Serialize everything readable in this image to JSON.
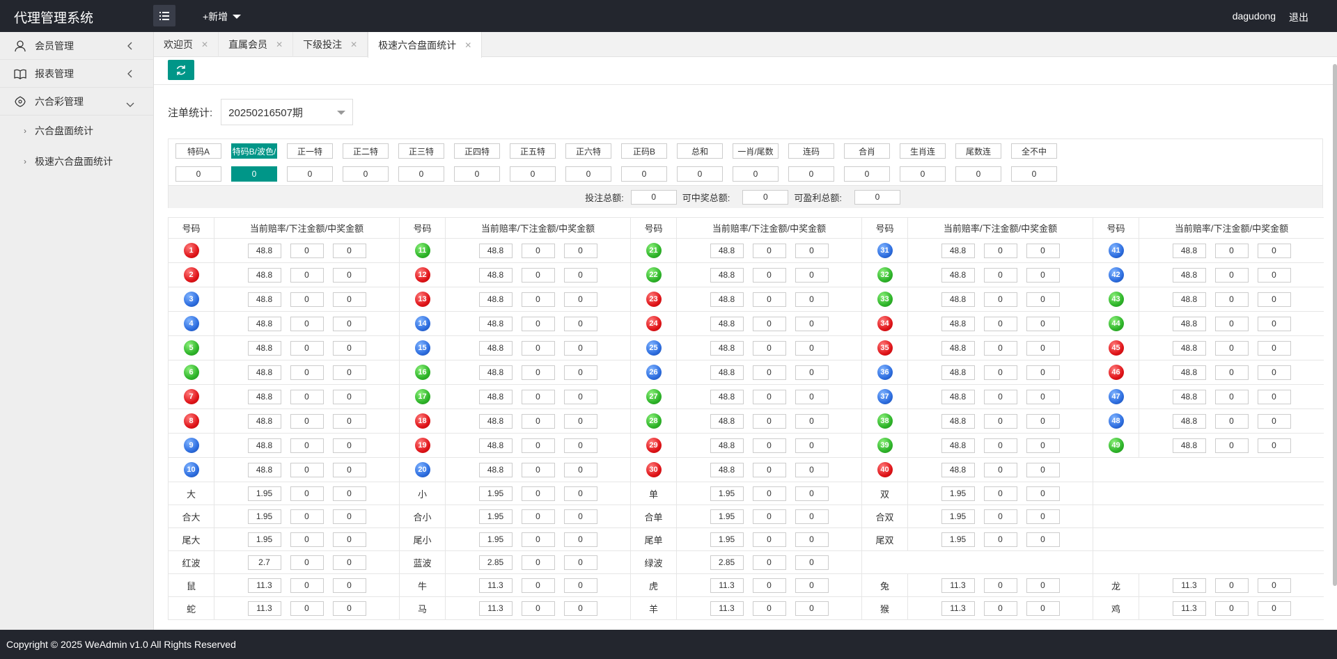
{
  "app": {
    "title": "代理管理系统",
    "add_new": "+新增",
    "user": "dagudong",
    "logout": "退出"
  },
  "sidebar": {
    "items": [
      {
        "label": "会员管理",
        "icon": "user-icon"
      },
      {
        "label": "报表管理",
        "icon": "book-icon"
      },
      {
        "label": "六合彩管理",
        "icon": "lottery-icon"
      }
    ],
    "sub_items": [
      "六合盘面统计",
      "极速六合盘面统计"
    ]
  },
  "tabs": [
    "欢迎页",
    "直属会员",
    "下级投注",
    "极速六合盘面统计"
  ],
  "active_tab": 3,
  "filter": {
    "label": "注单统计:",
    "period": "20250216507期"
  },
  "categories": {
    "labels": [
      "特码A",
      "特码B/波色/",
      "正一特",
      "正二特",
      "正三特",
      "正四特",
      "正五特",
      "正六特",
      "正码B",
      "总和",
      "一肖/尾数",
      "连码",
      "合肖",
      "生肖连",
      "尾数连",
      "全不中"
    ],
    "values": [
      "0",
      "0",
      "0",
      "0",
      "0",
      "0",
      "0",
      "0",
      "0",
      "0",
      "0",
      "0",
      "0",
      "0",
      "0",
      "0"
    ],
    "active_index": 1
  },
  "summary": {
    "bet_total_label": "投注总额:",
    "bet_total": "0",
    "win_total_label": "可中奖总额:",
    "win_total": "0",
    "profit_total_label": "可盈利总额:",
    "profit_total": "0"
  },
  "table": {
    "col_no": "号码",
    "col_vals": "当前赔率/下注金额/中奖金额",
    "odds_number": "48.8",
    "zero": "0",
    "ball_colors": {
      "1": "r",
      "2": "r",
      "3": "b",
      "4": "b",
      "5": "g",
      "6": "g",
      "7": "r",
      "8": "r",
      "9": "b",
      "10": "b",
      "11": "g",
      "12": "r",
      "13": "r",
      "14": "b",
      "15": "b",
      "16": "g",
      "17": "g",
      "18": "r",
      "19": "r",
      "20": "b",
      "21": "g",
      "22": "g",
      "23": "r",
      "24": "r",
      "25": "b",
      "26": "b",
      "27": "g",
      "28": "g",
      "29": "r",
      "30": "r",
      "31": "b",
      "32": "g",
      "33": "g",
      "34": "r",
      "35": "r",
      "36": "b",
      "37": "b",
      "38": "g",
      "39": "g",
      "40": "r",
      "41": "b",
      "42": "b",
      "43": "g",
      "44": "g",
      "45": "r",
      "46": "r",
      "47": "b",
      "48": "b",
      "49": "g"
    },
    "label_rows": [
      [
        [
          "大",
          "1.95"
        ],
        [
          "小",
          "1.95"
        ],
        [
          "单",
          "1.95"
        ],
        [
          "双",
          "1.95"
        ]
      ],
      [
        [
          "合大",
          "1.95"
        ],
        [
          "合小",
          "1.95"
        ],
        [
          "合单",
          "1.95"
        ],
        [
          "合双",
          "1.95"
        ]
      ],
      [
        [
          "尾大",
          "1.95"
        ],
        [
          "尾小",
          "1.95"
        ],
        [
          "尾单",
          "1.95"
        ],
        [
          "尾双",
          "1.95"
        ]
      ],
      [
        [
          "红波",
          "2.7"
        ],
        [
          "蓝波",
          "2.85"
        ],
        [
          "绿波",
          "2.85"
        ]
      ],
      [
        [
          "鼠",
          "11.3"
        ],
        [
          "牛",
          "11.3"
        ],
        [
          "虎",
          "11.3"
        ],
        [
          "兔",
          "11.3"
        ],
        [
          "龙",
          "11.3"
        ]
      ],
      [
        [
          "蛇",
          "11.3"
        ],
        [
          "马",
          "11.3"
        ],
        [
          "羊",
          "11.3"
        ],
        [
          "猴",
          "11.3"
        ],
        [
          "鸡",
          "11.3"
        ]
      ]
    ]
  },
  "footer": {
    "copyright": "Copyright © 2025 WeAdmin v1.0 All Rights Reserved"
  }
}
